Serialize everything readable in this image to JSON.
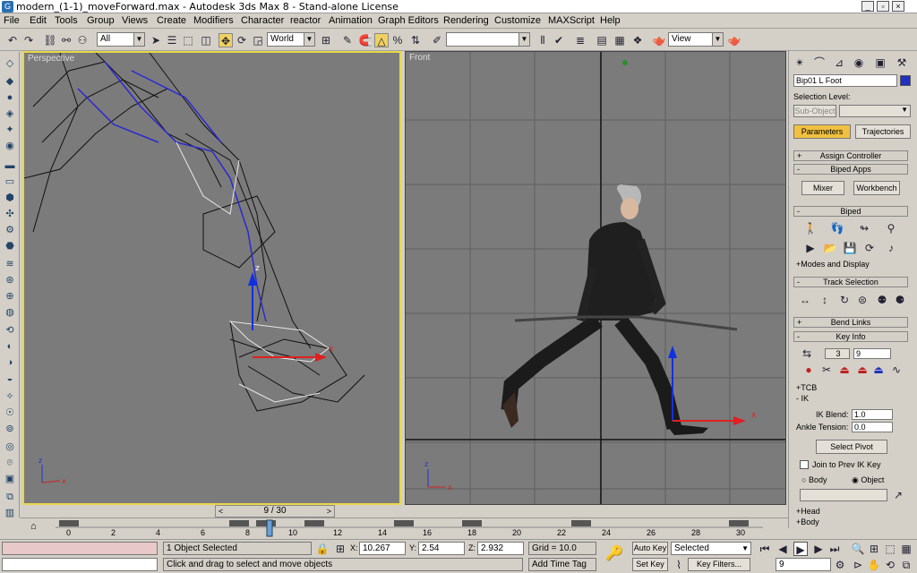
{
  "window": {
    "title": "modern_(1-1)_moveForward.max - Autodesk 3ds Max 8 - Stand-alone License",
    "app_icon": "G",
    "buttons": [
      "_",
      "▫",
      "×"
    ]
  },
  "menu": [
    "File",
    "Edit",
    "Tools",
    "Group",
    "Views",
    "Create",
    "Modifiers",
    "Character",
    "reactor",
    "Animation",
    "Graph Editors",
    "Rendering",
    "Customize",
    "MAXScript",
    "Help"
  ],
  "toolbar": {
    "selection_filter": "All",
    "ref_coord": "World",
    "named_selection": "",
    "render_view": "View"
  },
  "viewports": {
    "perspective_label": "Perspective",
    "front_label": "Front"
  },
  "cmdpanel": {
    "object_name": "Bip01 L Foot",
    "object_color": "#2030c0",
    "selection_level_label": "Selection Level:",
    "sub_object_label": "Sub-Object",
    "parameters_tab": "Parameters",
    "trajectories_tab": "Trajectories",
    "assign_controller": "Assign Controller",
    "biped_apps": "Biped Apps",
    "mixer": "Mixer",
    "workbench": "Workbench",
    "biped": "Biped",
    "modes_display": "+Modes and Display",
    "track_selection": "Track Selection",
    "bend_links": "Bend Links",
    "key_info": "Key Info",
    "key_num_1": "3",
    "key_num_2": "9",
    "tcb": "+TCB",
    "ik": "- IK",
    "ik_blend_label": "IK Blend:",
    "ik_blend_value": "1.0",
    "ankle_tension_label": "Ankle Tension:",
    "ankle_tension_value": "0.0",
    "select_pivot": "Select Pivot",
    "join_prev_ik": "Join to Prev IK Key",
    "body_label": "Body",
    "object_label": "Object",
    "head": "+Head",
    "body_roll": "+Body"
  },
  "timeline": {
    "slider_label": "9 / 30",
    "ticks": [
      "0",
      "2",
      "4",
      "6",
      "8",
      "10",
      "12",
      "14",
      "16",
      "18",
      "20",
      "22",
      "24",
      "26",
      "28",
      "30"
    ]
  },
  "status": {
    "selection_count": "1 Object Selected",
    "prompt": "Click and drag to select and move objects",
    "x_label": "X:",
    "x_value": "10.267",
    "y_label": "Y:",
    "y_value": "2.54",
    "z_label": "Z:",
    "z_value": "2.932",
    "grid": "Grid = 10.0",
    "add_time_tag": "Add Time Tag",
    "auto_key": "Auto Key",
    "set_key": "Set Key",
    "selected": "Selected",
    "key_filters": "Key Filters...",
    "current_frame": "9"
  }
}
